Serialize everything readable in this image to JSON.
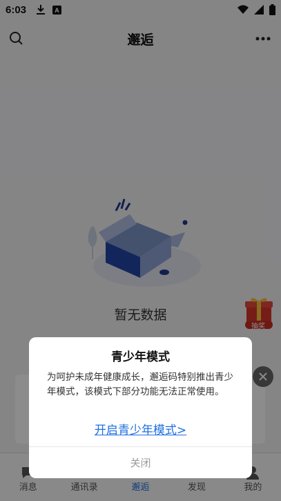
{
  "status_bar": {
    "time": "6:03"
  },
  "header": {
    "title": "邂逅"
  },
  "empty": {
    "text": "暂无数据"
  },
  "gift": {
    "label": "抽奖"
  },
  "tabs": [
    {
      "label": "消息"
    },
    {
      "label": "通讯录"
    },
    {
      "label": "邂逅"
    },
    {
      "label": "发现"
    },
    {
      "label": "我的"
    }
  ],
  "dialog": {
    "title": "青少年模式",
    "body": "为呵护未成年健康成长，邂逅码特别推出青少年模式，该模式下部分功能无法正常使用。",
    "link": "开启青少年模式>",
    "close": "关闭"
  },
  "colors": {
    "accent": "#1f6fe0",
    "overlay": "rgba(0,0,0,0.45)"
  }
}
